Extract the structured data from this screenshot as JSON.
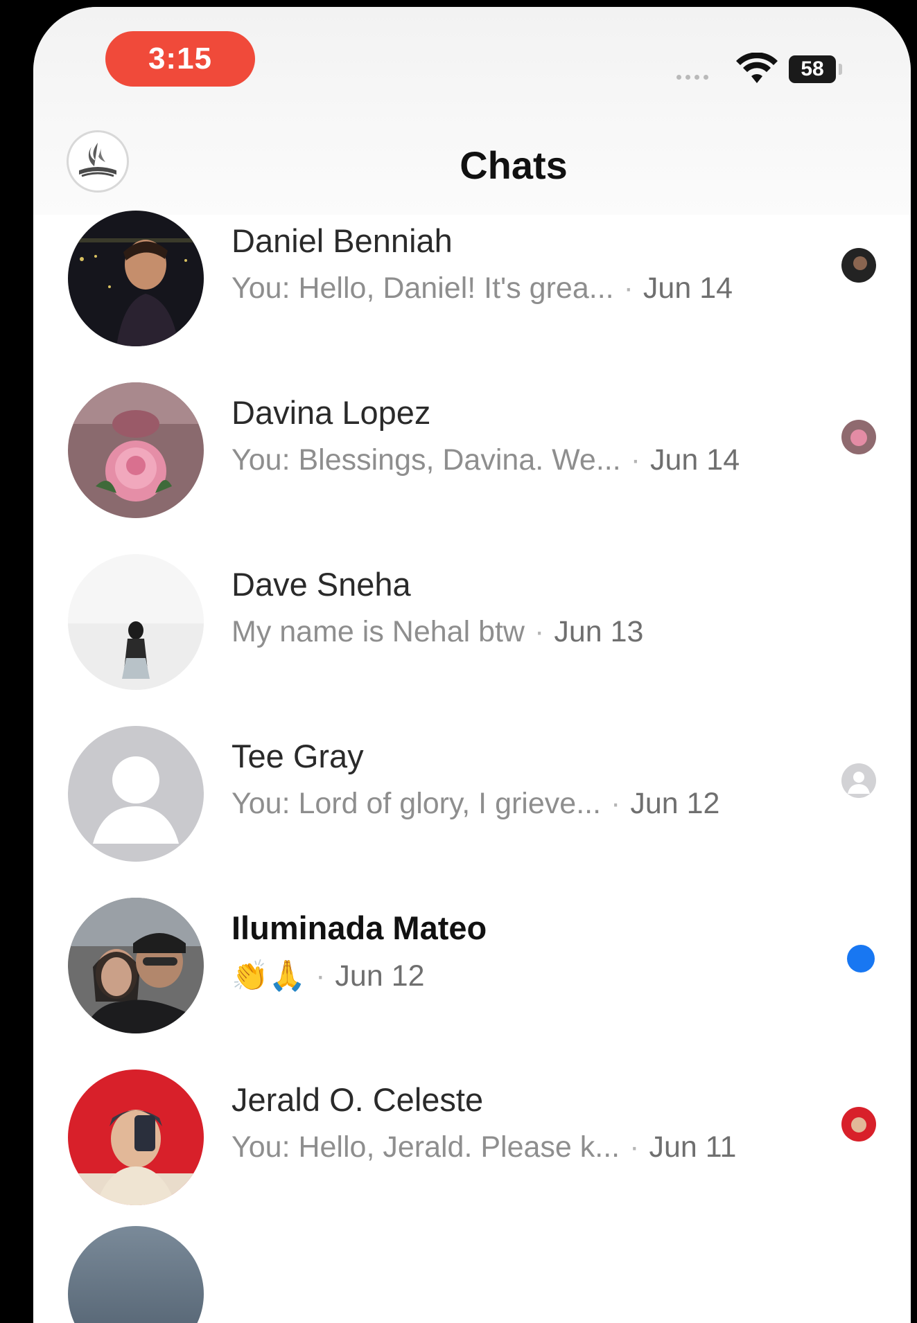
{
  "status_bar": {
    "time": "3:15",
    "battery": "58",
    "icons": [
      "signal-dots-icon",
      "wifi-icon",
      "battery-icon"
    ]
  },
  "header": {
    "title": "Chats",
    "logo_icon": "church-logo-icon"
  },
  "chats": [
    {
      "name": "Daniel Benniah",
      "preview": "You: Hello, Daniel! It's grea...",
      "date": "Jun 14",
      "status": "seen",
      "status_color": "#2b2b2b"
    },
    {
      "name": "Davina Lopez",
      "preview": "You: Blessings, Davina. We...",
      "date": "Jun 14",
      "status": "seen",
      "status_color": "#b56a72"
    },
    {
      "name": "Dave Sneha",
      "preview": "My name is Nehal btw",
      "date": "Jun 13",
      "status": "none"
    },
    {
      "name": "Tee Gray",
      "preview": "You: Lord of glory, I grieve...",
      "date": "Jun 12",
      "status": "seen",
      "status_color": "#c9c9c9"
    },
    {
      "name": "Iluminada Mateo",
      "preview": "👏🙏",
      "date": "Jun 12",
      "status": "unread",
      "status_color": "#1877f2"
    },
    {
      "name": "Jerald O. Celeste",
      "preview": "You: Hello, Jerald. Please k...",
      "date": "Jun 11",
      "status": "seen",
      "status_color": "#d8202a"
    }
  ],
  "colors": {
    "unread": "#1877f2",
    "time_pill": "#f04a3a",
    "title": "#111111"
  }
}
